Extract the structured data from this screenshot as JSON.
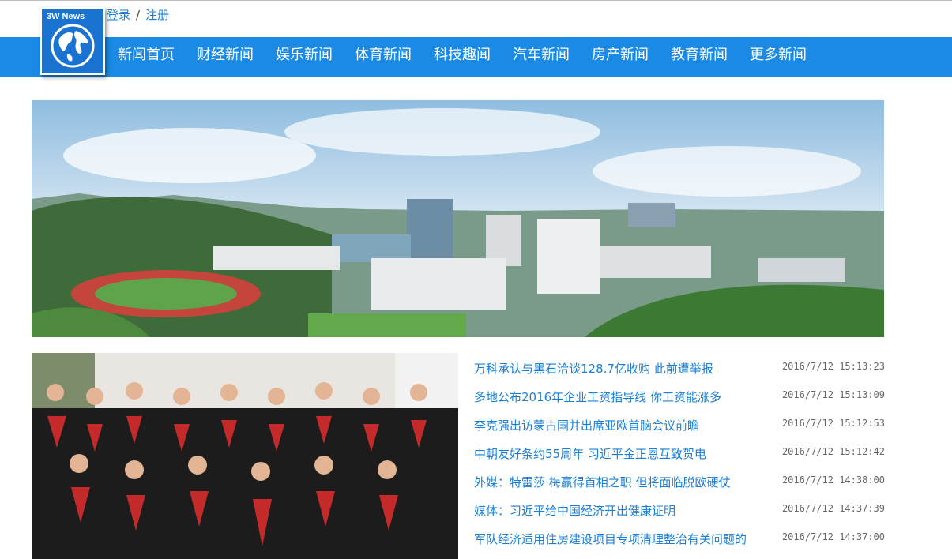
{
  "auth": {
    "login": "登录",
    "separator": "/",
    "register": "注册"
  },
  "logo": {
    "text": "3W News"
  },
  "nav": {
    "items": [
      "新闻首页",
      "财经新闻",
      "娱乐新闻",
      "体育新闻",
      "科技趣闻",
      "汽车新闻",
      "房产新闻",
      "教育新闻",
      "更多新闻"
    ]
  },
  "colors": {
    "nav_bg": "#1a8ae5",
    "link": "#1a7fd6"
  },
  "news": [
    {
      "title": "万科承认与黑石洽谈128.7亿收购 此前遭举报",
      "time": "2016/7/12 15:13:23"
    },
    {
      "title": "多地公布2016年企业工资指导线 你工资能涨多",
      "time": "2016/7/12 15:13:09"
    },
    {
      "title": "李克强出访蒙古国并出席亚欧首脑会议前瞻",
      "time": "2016/7/12 15:12:53"
    },
    {
      "title": "中朝友好条约55周年 习近平金正恩互致贺电",
      "time": "2016/7/12 15:12:42"
    },
    {
      "title": "外媒：特雷莎·梅赢得首相之职 但将面临脱欧硬仗",
      "time": "2016/7/12 14:38:00"
    },
    {
      "title": "媒体：习近平给中国经济开出健康证明",
      "time": "2016/7/12 14:37:39"
    },
    {
      "title": "军队经济适用住房建设项目专项清理整治有关问题的",
      "time": "2016/7/12 14:37:00"
    }
  ]
}
